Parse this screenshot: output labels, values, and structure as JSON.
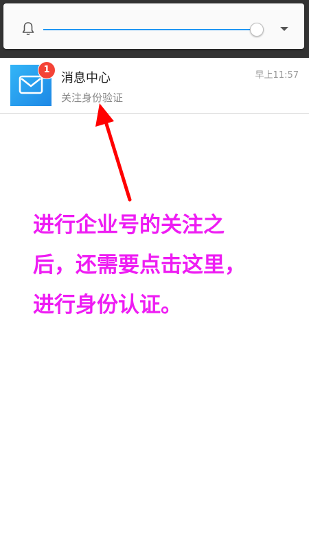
{
  "colors": {
    "shade": "#333333",
    "accent": "#2196f3",
    "badge": "#f44336",
    "annotation_text": "#ee1cf3",
    "arrow": "#ff0000"
  },
  "notification_bar": {
    "bell_icon": "bell-icon",
    "volume_level": 0.98,
    "expand_icon": "chevron-down-icon"
  },
  "message_list": {
    "items": [
      {
        "icon": "envelope-icon",
        "badge": "1",
        "title": "消息中心",
        "subtitle": "关注身份验证",
        "time": "早上11:57"
      }
    ]
  },
  "annotation": {
    "lines": [
      "进行企业号的关注之",
      "后，还需要点击这里，",
      "进行身份认证。"
    ]
  }
}
